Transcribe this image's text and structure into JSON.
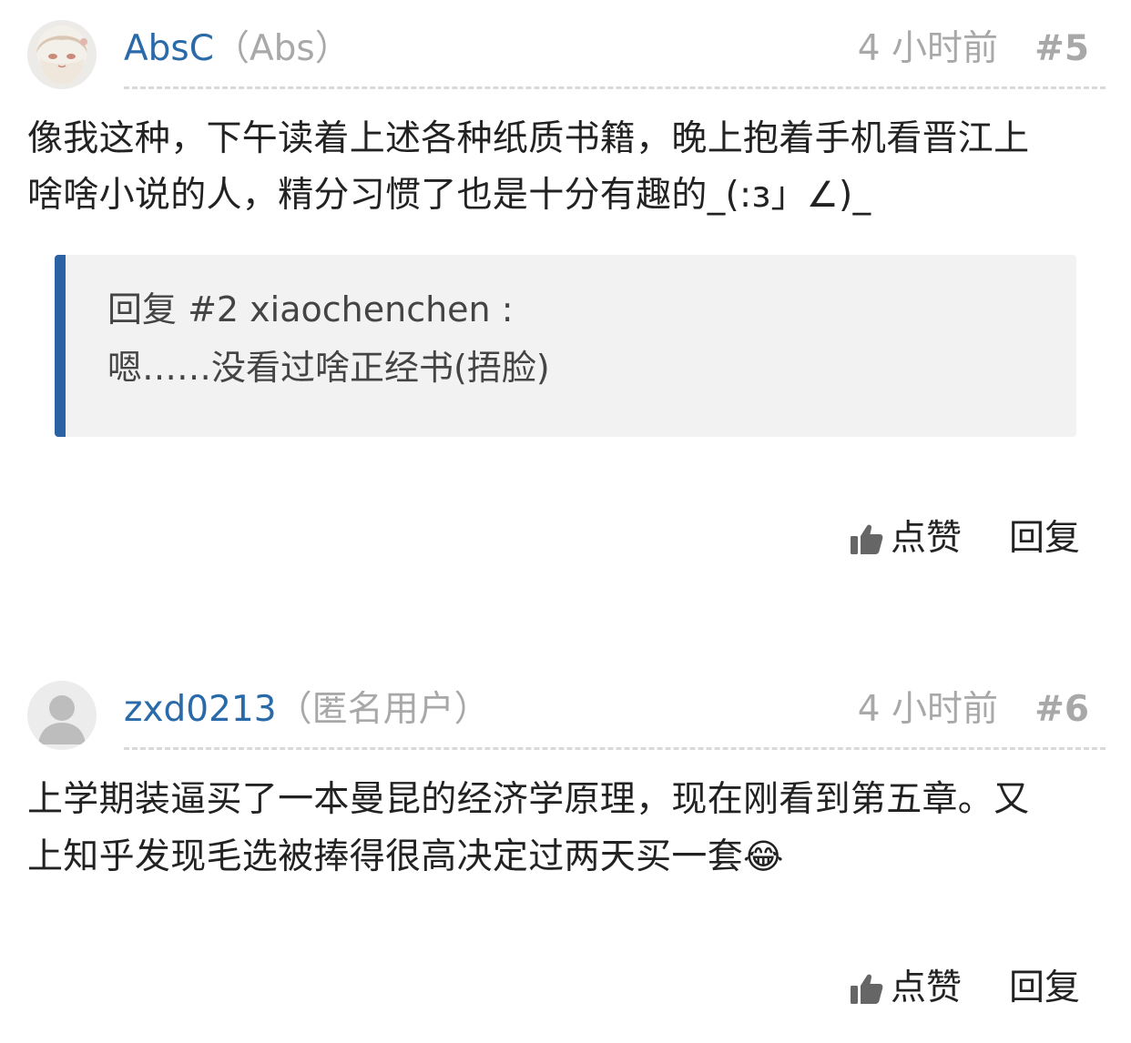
{
  "posts": [
    {
      "username": "AbsC",
      "nickname": "（Abs）",
      "time": "4 小时前",
      "floor": "#5",
      "avatar_icon": "anime-girl-avatar",
      "content_lines": [
        "像我这种，下午读着上述各种纸质书籍，晚上抱着手机看晋江上",
        "啥啥小说的人，精分习惯了也是十分有趣的_(:з」∠)_"
      ],
      "quote": {
        "header": "回复 #2 xiaochenchen :",
        "text": "嗯……没看过啥正经书(捂脸)"
      },
      "like_label": "点赞",
      "reply_label": "回复"
    },
    {
      "username": "zxd0213",
      "nickname": "（匿名用户）",
      "time": "4 小时前",
      "floor": "#6",
      "avatar_icon": "default-user-avatar",
      "content_lines": [
        "上学期装逼买了一本曼昆的经济学原理，现在刚看到第五章。又",
        "上知乎发现毛选被捧得很高决定过两天买一套"
      ],
      "content_emoji": "😂",
      "like_label": "点赞",
      "reply_label": "回复"
    }
  ],
  "colors": {
    "username": "#2a6aa8",
    "meta": "#a8a8a8",
    "quote_bar": "#2b62a4",
    "quote_bg": "#f2f2f2"
  }
}
